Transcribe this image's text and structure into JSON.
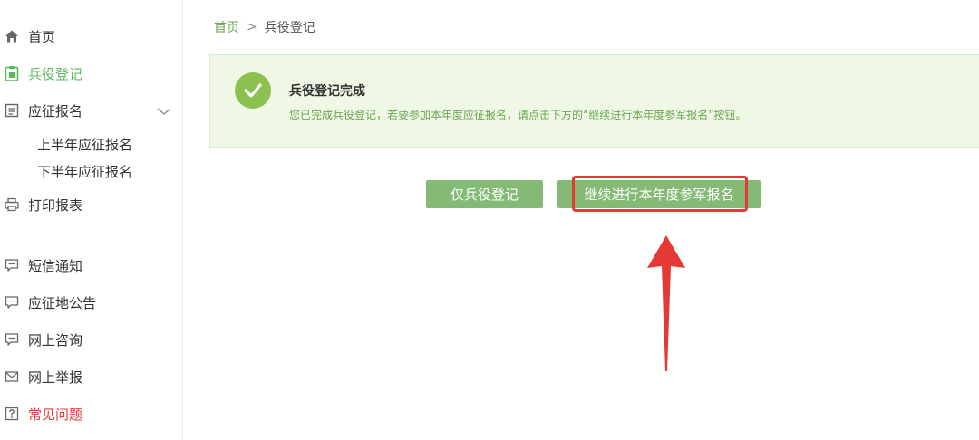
{
  "sidebar": {
    "items": [
      {
        "label": "首页",
        "icon": "home-icon"
      },
      {
        "label": "兵役登记",
        "icon": "clipboard-icon",
        "active": true
      },
      {
        "label": "应征报名",
        "icon": "form-icon",
        "expanded": true
      },
      {
        "label": "打印报表",
        "icon": "printer-icon"
      },
      {
        "label": "短信通知",
        "icon": "chat-icon"
      },
      {
        "label": "应征地公告",
        "icon": "chat-icon"
      },
      {
        "label": "网上咨询",
        "icon": "chat-icon"
      },
      {
        "label": "网上举报",
        "icon": "mail-icon"
      },
      {
        "label": "常见问题",
        "icon": "question-icon"
      }
    ],
    "sub_items": [
      "上半年应征报名",
      "下半年应征报名"
    ]
  },
  "breadcrumb": {
    "home": "首页",
    "separator": ">",
    "current": "兵役登记"
  },
  "success": {
    "title": "兵役登记完成",
    "description": "您已完成兵役登记，若要参加本年度应征报名，请点击下方的“继续进行本年度参军报名”按钮。"
  },
  "buttons": {
    "register_only": "仅兵役登记",
    "continue": "继续进行本年度参军报名"
  },
  "colors": {
    "accent": "#5cb85c",
    "button": "#85ba76",
    "panel_bg": "#eef8e4",
    "highlight": "#e53935"
  }
}
